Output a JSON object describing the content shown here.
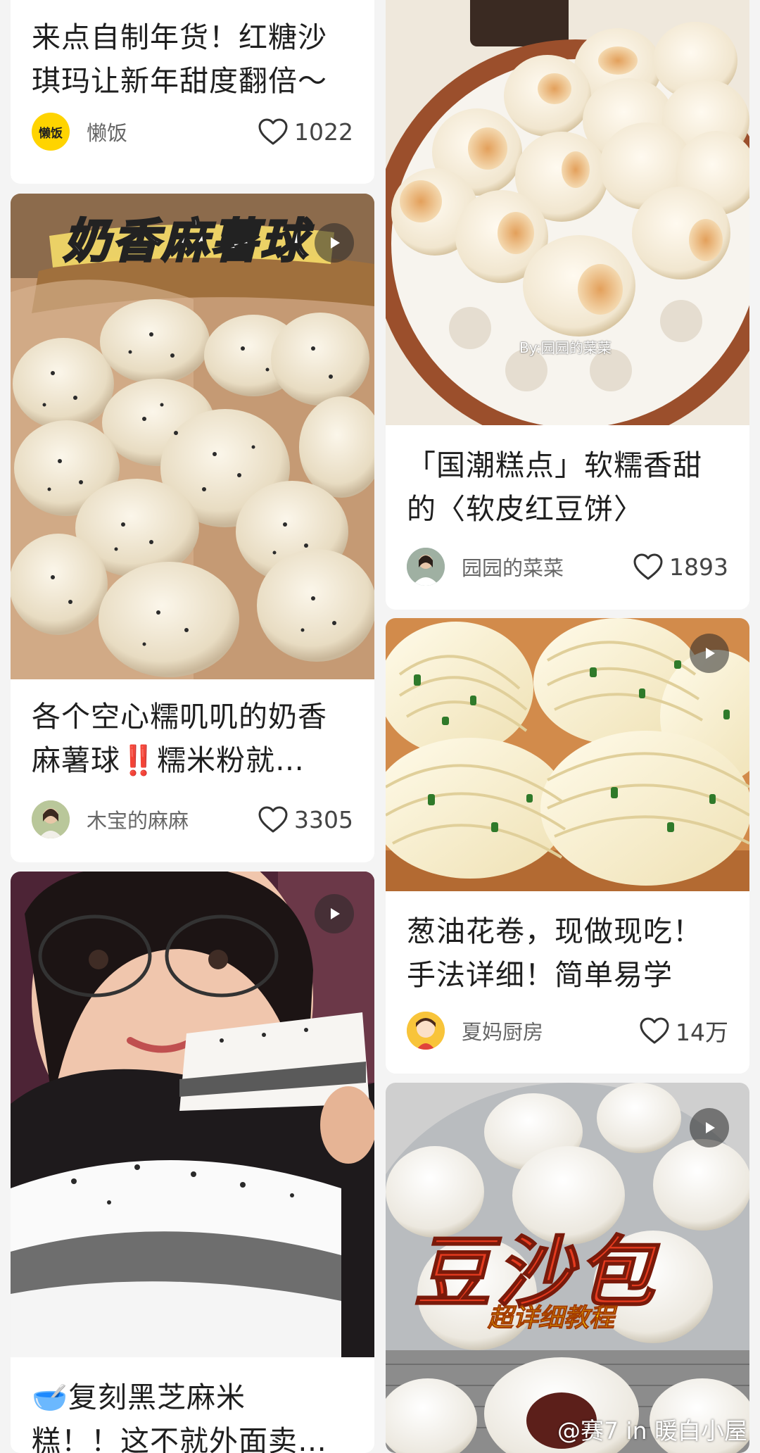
{
  "cards": {
    "c1": {
      "title": "来点自制年货！红糖沙\n琪玛让新年甜度翻倍～",
      "avatar_text": "懒饭",
      "author": "懒饭",
      "likes": "1022"
    },
    "c2": {
      "overlay": "奶香麻薯球",
      "title": "各个空心糯叽叽的奶香\n麻薯球‼️糯米粉就…",
      "author": "木宝的麻麻",
      "likes": "3305"
    },
    "c3": {
      "title": "🥣复刻黑芝麻米\n糕！！这不就外面卖…"
    },
    "r1": {
      "image_caption": "By:园园的菜菜",
      "title": "「国潮糕点」软糯香甜\n的〈软皮红豆饼〉",
      "author": "园园的菜菜",
      "likes": "1893"
    },
    "r2": {
      "title": "葱油花卷，现做现吃！\n手法详细！简单易学",
      "author": "夏妈厨房",
      "likes": "14万"
    },
    "r3": {
      "overlay_main": "豆沙包",
      "overlay_sub": "超详细教程"
    }
  },
  "watermark": "@赛7 in 暖白小屋",
  "icons": {
    "like": "heart-outline-icon",
    "play": "play-icon"
  },
  "colors": {
    "accent_yellow": "#ffd400",
    "overlay_red": "#e63b1f"
  }
}
